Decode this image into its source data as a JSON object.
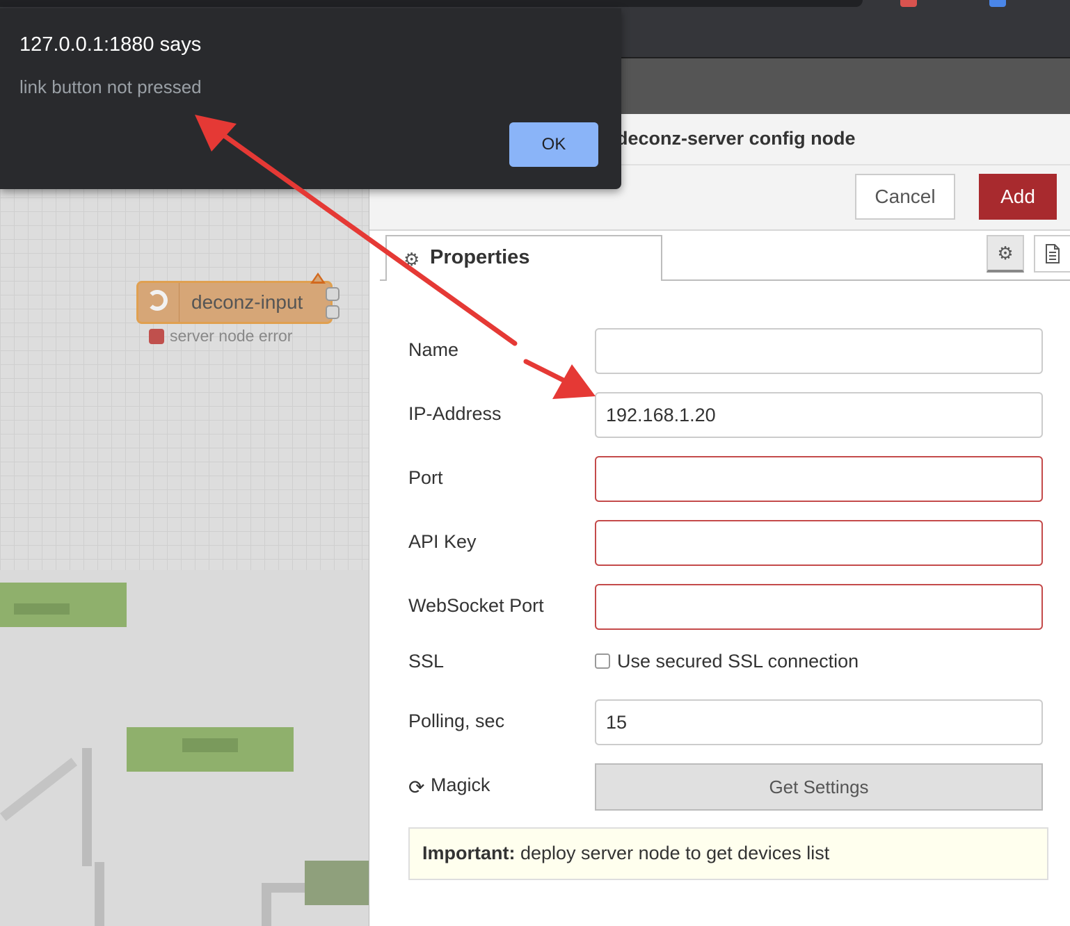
{
  "alert": {
    "title": "127.0.0.1:1880 says",
    "message": "link button not pressed",
    "ok_label": "OK"
  },
  "workspace": {
    "node": {
      "label": "deconz-input",
      "status": "server node error"
    }
  },
  "editor": {
    "title": "deconz-server config node",
    "cancel_label": "Cancel",
    "add_label": "Add",
    "tabs": {
      "properties_label": "Properties"
    },
    "fields": {
      "name": {
        "label": "Name",
        "value": ""
      },
      "ip": {
        "label": "IP-Address",
        "value": "192.168.1.20"
      },
      "port": {
        "label": "Port",
        "value": ""
      },
      "apikey": {
        "label": "API Key",
        "value": ""
      },
      "ws_port": {
        "label": "WebSocket Port",
        "value": ""
      },
      "ssl": {
        "label": "SSL",
        "checkbox_label": "Use secured SSL connection",
        "checked": false
      },
      "polling": {
        "label": "Polling, sec",
        "value": "15"
      },
      "magick": {
        "label": "Magick",
        "button_label": "Get Settings"
      }
    },
    "tip": {
      "bold": "Important:",
      "text": " deploy server node to get devices list"
    }
  },
  "colors": {
    "add_button": "#a82a2e",
    "annotation_arrow": "#e53935",
    "alert_ok": "#8ab4f8",
    "invalid_border": "#c44a4a",
    "node_fill": "#d6a677"
  },
  "icons": [
    "gear-icon",
    "document-icon",
    "refresh-icon",
    "node-icon",
    "warning-icon"
  ]
}
